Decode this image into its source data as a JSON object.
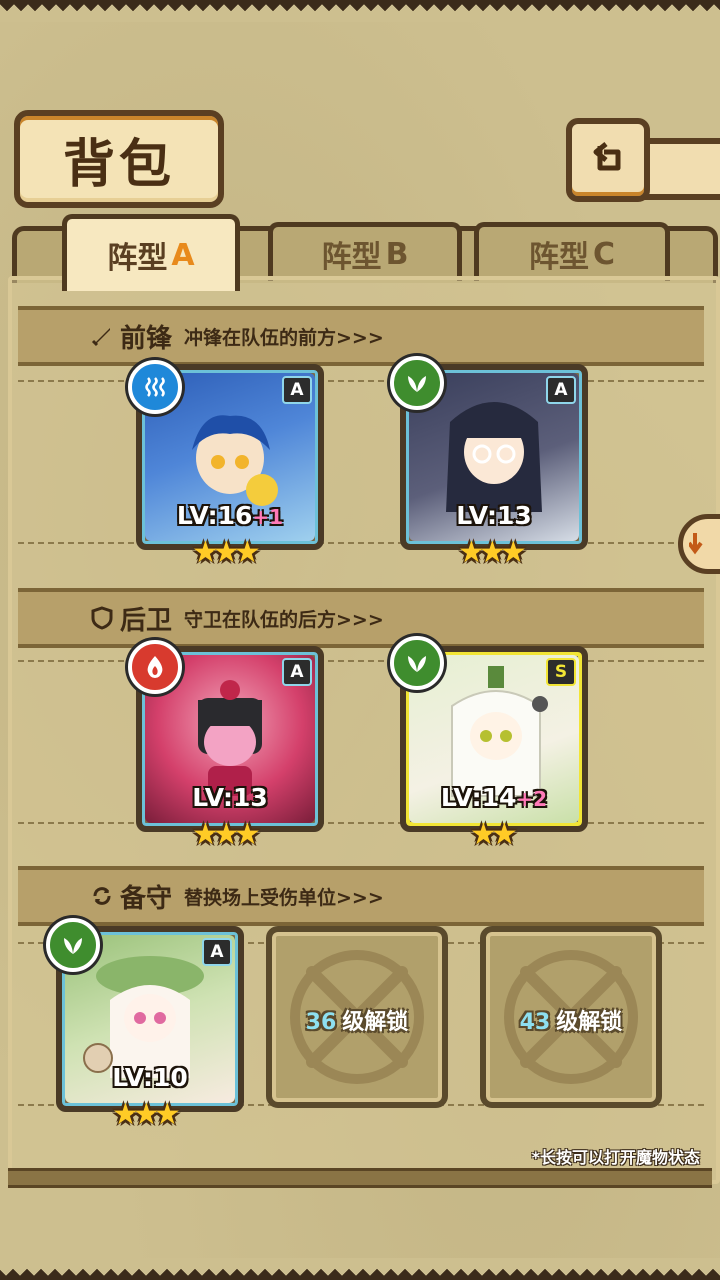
{
  "header": {
    "title": "背包"
  },
  "tabs": [
    {
      "prefix": "阵型",
      "letter": "A",
      "active": true
    },
    {
      "prefix": "阵型",
      "letter": "B",
      "active": false
    },
    {
      "prefix": "阵型",
      "letter": "C",
      "active": false
    }
  ],
  "sections": {
    "front": {
      "title": "前锋",
      "subtitle": "冲锋在队伍的前方>>>",
      "icon": "sword-icon"
    },
    "back": {
      "title": "后卫",
      "subtitle": "守卫在队伍的后方>>>",
      "icon": "shield-icon"
    },
    "reserve": {
      "title": "备守",
      "subtitle": "替换场上受伤单位>>>",
      "icon": "swap-icon"
    }
  },
  "units": {
    "front_1": {
      "element": "water",
      "rank": "A",
      "level": "LV:16",
      "bonus": "+1",
      "stars": 3,
      "art_colors": [
        "#2e5fb8",
        "#9fd0ee"
      ]
    },
    "front_2": {
      "element": "grass",
      "rank": "A",
      "level": "LV:13",
      "bonus": "",
      "stars": 3,
      "art_colors": [
        "#3a3f5c",
        "#d6dde6"
      ]
    },
    "back_1": {
      "element": "fire",
      "rank": "A",
      "level": "LV:13",
      "bonus": "",
      "stars": 3,
      "art_colors": [
        "#d4406b",
        "#f2a3b8"
      ]
    },
    "back_2": {
      "element": "grass",
      "rank": "S",
      "level": "LV:14",
      "bonus": "+2",
      "stars": 2,
      "art_colors": [
        "#c9e0a8",
        "#f4f1e4"
      ]
    },
    "reserve_1": {
      "element": "grass",
      "rank": "A",
      "level": "LV:10",
      "bonus": "",
      "stars": 3,
      "art_colors": [
        "#9ac27a",
        "#f7ebe0"
      ]
    }
  },
  "locked_slots": [
    {
      "level": "36",
      "label": "级解锁"
    },
    {
      "level": "43",
      "label": "级解锁"
    }
  ],
  "footnote": "*长按可以打开魔物状态",
  "colors": {
    "parchment": "#cdbf8f",
    "frame_dark": "#4a3a26",
    "accent_orange": "#e88a1c",
    "card_border_a": "#6cc1d8",
    "card_border_s": "#f2e535"
  }
}
